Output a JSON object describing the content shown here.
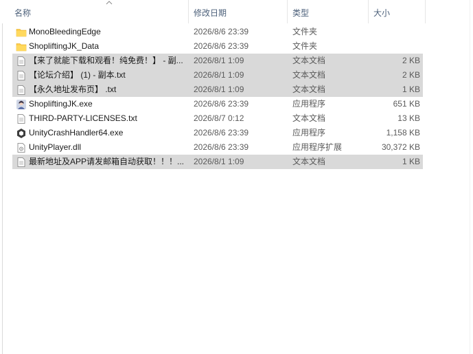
{
  "columns": {
    "name": "名称",
    "date": "修改日期",
    "type": "类型",
    "size": "大小"
  },
  "files": [
    {
      "icon": "folder-icon",
      "name": "MonoBleedingEdge",
      "date": "2026/8/6 23:39",
      "type": "文件夹",
      "size": "",
      "selected": false
    },
    {
      "icon": "folder-icon",
      "name": "ShopliftingJK_Data",
      "date": "2026/8/6 23:39",
      "type": "文件夹",
      "size": "",
      "selected": false
    },
    {
      "icon": "text-file-icon",
      "name": "【来了就能下载和观看！纯免费！】 - 副...",
      "date": "2026/8/1 1:09",
      "type": "文本文档",
      "size": "2 KB",
      "selected": true
    },
    {
      "icon": "text-file-icon",
      "name": "【论坛介绍】 (1) - 副本.txt",
      "date": "2026/8/1 1:09",
      "type": "文本文档",
      "size": "2 KB",
      "selected": true
    },
    {
      "icon": "text-file-icon",
      "name": "【永久地址发布页】 .txt",
      "date": "2026/8/1 1:09",
      "type": "文本文档",
      "size": "1 KB",
      "selected": true
    },
    {
      "icon": "app-exe-icon",
      "name": "ShopliftingJK.exe",
      "date": "2026/8/6 23:39",
      "type": "应用程序",
      "size": "651 KB",
      "selected": false
    },
    {
      "icon": "text-file-icon",
      "name": "THIRD-PARTY-LICENSES.txt",
      "date": "2026/8/7 0:12",
      "type": "文本文档",
      "size": "13 KB",
      "selected": false
    },
    {
      "icon": "unity-icon",
      "name": "UnityCrashHandler64.exe",
      "date": "2026/8/6 23:39",
      "type": "应用程序",
      "size": "1,158 KB",
      "selected": false
    },
    {
      "icon": "dll-file-icon",
      "name": "UnityPlayer.dll",
      "date": "2026/8/6 23:39",
      "type": "应用程序扩展",
      "size": "30,372 KB",
      "selected": false
    },
    {
      "icon": "text-file-icon",
      "name": "最新地址及APP请发邮箱自动获取！！！...",
      "date": "2026/8/1 1:09",
      "type": "文本文档",
      "size": "1 KB",
      "selected": true
    }
  ],
  "colors": {
    "selection": "#d9d9d9",
    "header_text": "#4c607a",
    "folder": "#ffcd4a"
  }
}
